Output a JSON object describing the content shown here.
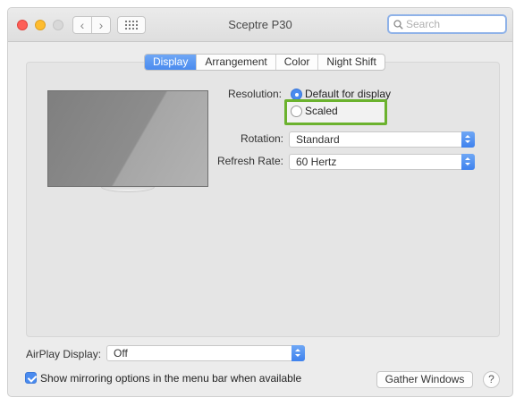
{
  "window": {
    "title": "Sceptre P30",
    "back_icon": "‹",
    "forward_icon": "›"
  },
  "search": {
    "placeholder": "Search"
  },
  "tabs": [
    {
      "label": "Display",
      "active": true
    },
    {
      "label": "Arrangement",
      "active": false
    },
    {
      "label": "Color",
      "active": false
    },
    {
      "label": "Night Shift",
      "active": false
    }
  ],
  "resolution": {
    "label": "Resolution:",
    "options": [
      {
        "label": "Default for display",
        "selected": true
      },
      {
        "label": "Scaled",
        "selected": false
      }
    ]
  },
  "rotation": {
    "label": "Rotation:",
    "value": "Standard"
  },
  "refresh_rate": {
    "label": "Refresh Rate:",
    "value": "60 Hertz"
  },
  "airplay": {
    "label": "AirPlay Display:",
    "value": "Off"
  },
  "mirroring": {
    "label": "Show mirroring options in the menu bar when available",
    "checked": true
  },
  "buttons": {
    "gather_windows": "Gather Windows",
    "help": "?"
  },
  "colors": {
    "accent": "#4a8bef",
    "highlight": "#6bb22e"
  }
}
